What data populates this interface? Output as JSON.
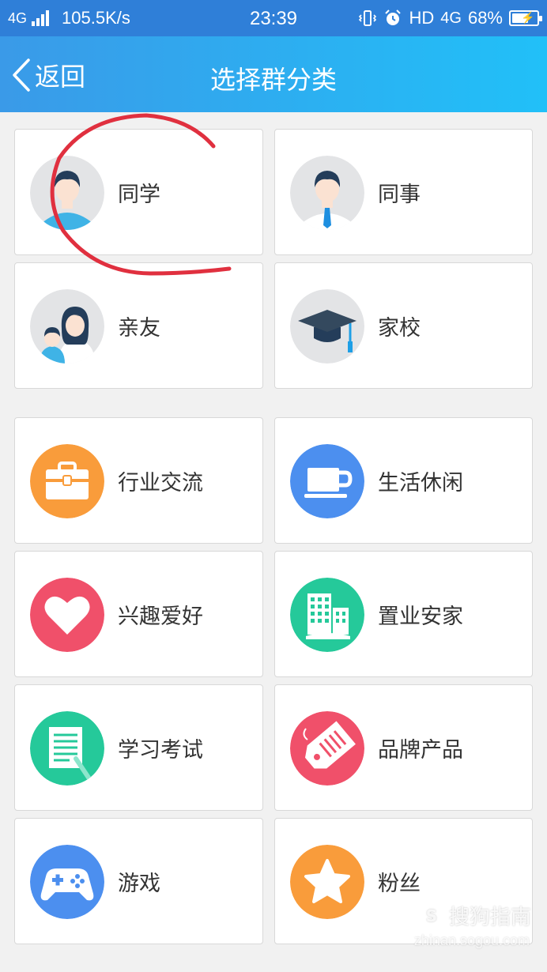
{
  "status_bar": {
    "network": "4G",
    "speed": "105.5K/s",
    "time": "23:39",
    "hd": "HD",
    "net2": "4G",
    "battery": "68%",
    "battery_level": 0.68
  },
  "navbar": {
    "back_label": "返回",
    "title": "选择群分类"
  },
  "categories": [
    {
      "label": "同学",
      "icon": "classmate-avatar-icon"
    },
    {
      "label": "同事",
      "icon": "colleague-avatar-icon"
    },
    {
      "label": "亲友",
      "icon": "family-avatar-icon"
    },
    {
      "label": "家校",
      "icon": "graduation-cap-icon"
    },
    {
      "label": "行业交流",
      "icon": "briefcase-icon",
      "color": "#f99c3b"
    },
    {
      "label": "生活休闲",
      "icon": "coffee-cup-icon",
      "color": "#4c8fef"
    },
    {
      "label": "兴趣爱好",
      "icon": "heart-icon",
      "color": "#f0506a"
    },
    {
      "label": "置业安家",
      "icon": "buildings-icon",
      "color": "#25c99a"
    },
    {
      "label": "学习考试",
      "icon": "notebook-icon",
      "color": "#25c99a"
    },
    {
      "label": "品牌产品",
      "icon": "price-tag-icon",
      "color": "#f0506a"
    },
    {
      "label": "游戏",
      "icon": "gamepad-icon",
      "color": "#4c8fef"
    },
    {
      "label": "粉丝",
      "icon": "star-icon",
      "color": "#f99c3b"
    }
  ],
  "watermark": {
    "logo": "S",
    "text": "搜狗指南",
    "url": "zhinan.sogou.com"
  }
}
